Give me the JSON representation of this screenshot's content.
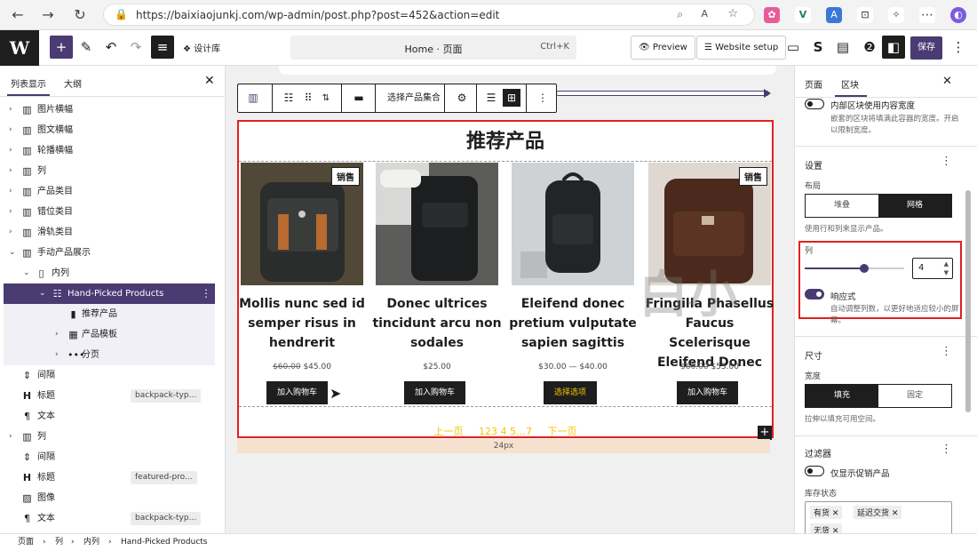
{
  "browser": {
    "url": "https://baixiaojunkj.com/wp-admin/post.php?post=452&action=edit"
  },
  "toolbar": {
    "design_label": "设计库",
    "doc_title": "Home · 页面",
    "doc_shortcut": "Ctrl+K",
    "preview_label": "Preview",
    "website_setup_label": "Website setup",
    "save_label": "保存"
  },
  "left": {
    "tabs": [
      "列表显示",
      "大纲"
    ],
    "items": [
      {
        "label": "图片横幅"
      },
      {
        "label": "图文横幅"
      },
      {
        "label": "轮播横幅"
      },
      {
        "label": "列"
      },
      {
        "label": "产品类目"
      },
      {
        "label": "错位类目"
      },
      {
        "label": "滑轨类目"
      },
      {
        "label": "手动产品展示"
      },
      {
        "label": "内列"
      },
      {
        "label": "Hand-Picked Products"
      },
      {
        "label": "推荐产品"
      },
      {
        "label": "产品模板"
      },
      {
        "label": "分页"
      },
      {
        "label": "间隔"
      },
      {
        "label": "标题",
        "tag": "backpack-typ..."
      },
      {
        "label": "文本"
      },
      {
        "label": "列"
      },
      {
        "label": "间隔"
      },
      {
        "label": "标题",
        "tag": "featured-pro..."
      },
      {
        "label": "图像"
      },
      {
        "label": "文本",
        "tag": "backpack-typ..."
      }
    ]
  },
  "blocktoolbar": {
    "select_label": "选择产品集合"
  },
  "block": {
    "title": "推荐产品",
    "sale_badge": "销售",
    "products": [
      {
        "name": "Mollis nunc sed id semper risus in hendrerit",
        "old_price": "$60.00",
        "price": "$45.00",
        "button": "加入购物车"
      },
      {
        "name": "Donec ultrices tincidunt arcu non sodales",
        "old_price": "",
        "price": "$25.00",
        "button": "加入购物车"
      },
      {
        "name": "Eleifend donec pretium vulputate sapien sagittis",
        "old_price": "",
        "price": "$30.00 — $40.00",
        "button": "选择选项"
      },
      {
        "name": "Fringilla Phasellus Faucus Scelerisque Eleifend Donec",
        "old_price": "$60.00",
        "price": "$55.00",
        "button": "加入购物车"
      }
    ],
    "pager": {
      "prev": "上一页",
      "pages": "123 4 5…7",
      "next": "下一页"
    }
  },
  "spacer": {
    "label": "24px"
  },
  "watermark": "白小",
  "right": {
    "tabs": [
      "页面",
      "区块"
    ],
    "inner_width_label": "内部区块使用内容宽度",
    "inner_width_desc": "嵌套的区块将填满此容器的宽度。开启以限制宽度。",
    "settings_title": "设置",
    "layout_label": "布局",
    "layout_options": [
      "堆叠",
      "网格"
    ],
    "layout_desc": "使用行和列来显示产品。",
    "columns_label": "列",
    "columns_value": 4,
    "responsive_label": "响应式",
    "responsive_desc": "自动调整列数，以更好地适应较小的屏幕。",
    "size_title": "尺寸",
    "width_label": "宽度",
    "width_options": [
      "填充",
      "固定"
    ],
    "width_desc": "拉伸以填充可用空间。",
    "filter_title": "过滤器",
    "sale_only_label": "仅显示促销产品",
    "stock_label": "库存状态",
    "stock_tags": [
      "有货",
      "延迟交货",
      "无货"
    ]
  },
  "breadcrumb": [
    "页面",
    "列",
    "内列",
    "Hand-Picked Products"
  ]
}
